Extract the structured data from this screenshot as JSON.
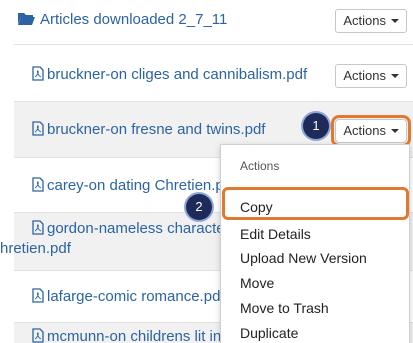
{
  "folder": {
    "label": "Articles downloaded 2_7_11",
    "icon": "folder-open-icon"
  },
  "actions_label": "Actions",
  "files": [
    {
      "label": "bruckner-on cliges and cannibalism.pdf"
    },
    {
      "label": "bruckner-on fresne and twins.pdf"
    },
    {
      "label": "carey-on dating Chretien.pdf"
    },
    {
      "label": "gordon-nameless character",
      "label2": "hretien.pdf"
    },
    {
      "label": "lafarge-comic romance.pdf"
    },
    {
      "label": "mcmunn-on childrens lit in tr"
    }
  ],
  "menu": {
    "header": "Actions",
    "items": [
      "Copy",
      "Edit Details",
      "Upload New Version",
      "Move",
      "Move to Trash",
      "Duplicate"
    ]
  },
  "callouts": {
    "step1": "1",
    "step2": "2"
  },
  "colors": {
    "link": "#2b63a5",
    "highlight": "#e07a2e",
    "callout": "#1e2a57"
  }
}
